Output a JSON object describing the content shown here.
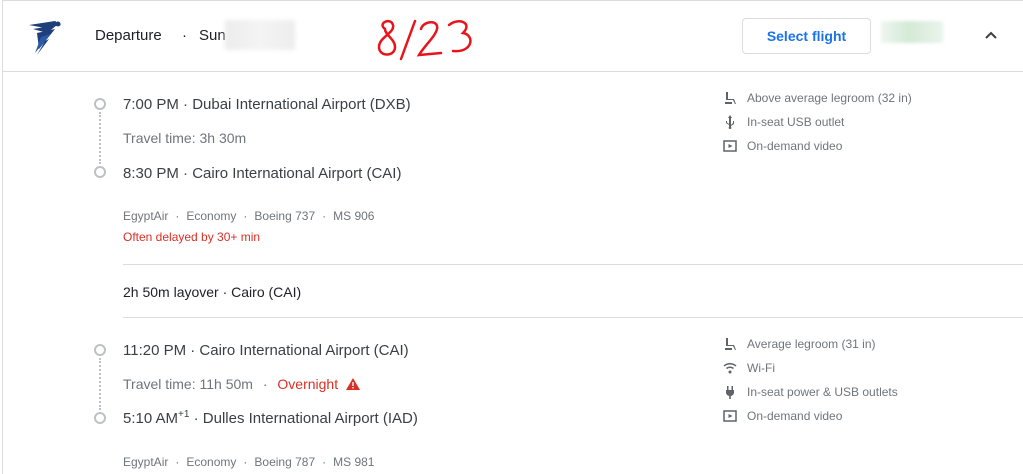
{
  "header": {
    "title": "Departure",
    "dot": "·",
    "date_prefix": "Sun",
    "handwritten_note": "8/23",
    "select_button": "Select flight",
    "collapse_icon": "chevron-up-icon",
    "brand_color": "#1a73e8"
  },
  "segments": [
    {
      "depart": "7:00 PM · Dubai International Airport (DXB)",
      "travel_time": "Travel time: 3h 30m",
      "arrive": "8:30 PM · Cairo International Airport (CAI)",
      "meta": [
        "EgyptAir",
        "Economy",
        "Boeing 737",
        "MS 906"
      ],
      "delay": "Often delayed by 30+ min",
      "amenities": [
        {
          "icon": "seat-icon",
          "label": "Above average legroom (32 in)"
        },
        {
          "icon": "usb-icon",
          "label": "In-seat USB outlet"
        },
        {
          "icon": "video-icon",
          "label": "On-demand video"
        }
      ]
    },
    {
      "depart": "11:20 PM · Cairo International Airport (CAI)",
      "travel_time": "Travel time: 11h 50m",
      "overnight": "Overnight",
      "arrive_time": "5:10 AM",
      "arrive_sup": "+1",
      "arrive_rest": " · Dulles International Airport (IAD)",
      "meta": [
        "EgyptAir",
        "Economy",
        "Boeing 787",
        "MS 981"
      ],
      "amenities": [
        {
          "icon": "seat-icon",
          "label": "Average legroom (31 in)"
        },
        {
          "icon": "wifi-icon",
          "label": "Wi-Fi"
        },
        {
          "icon": "power-plug-icon",
          "label": "In-seat power & USB outlets"
        },
        {
          "icon": "video-icon",
          "label": "On-demand video"
        }
      ]
    }
  ],
  "layover": "2h 50m layover · Cairo (CAI)",
  "colors": {
    "warning": "#d93025",
    "muted": "#70757a",
    "text": "#3c4043"
  }
}
